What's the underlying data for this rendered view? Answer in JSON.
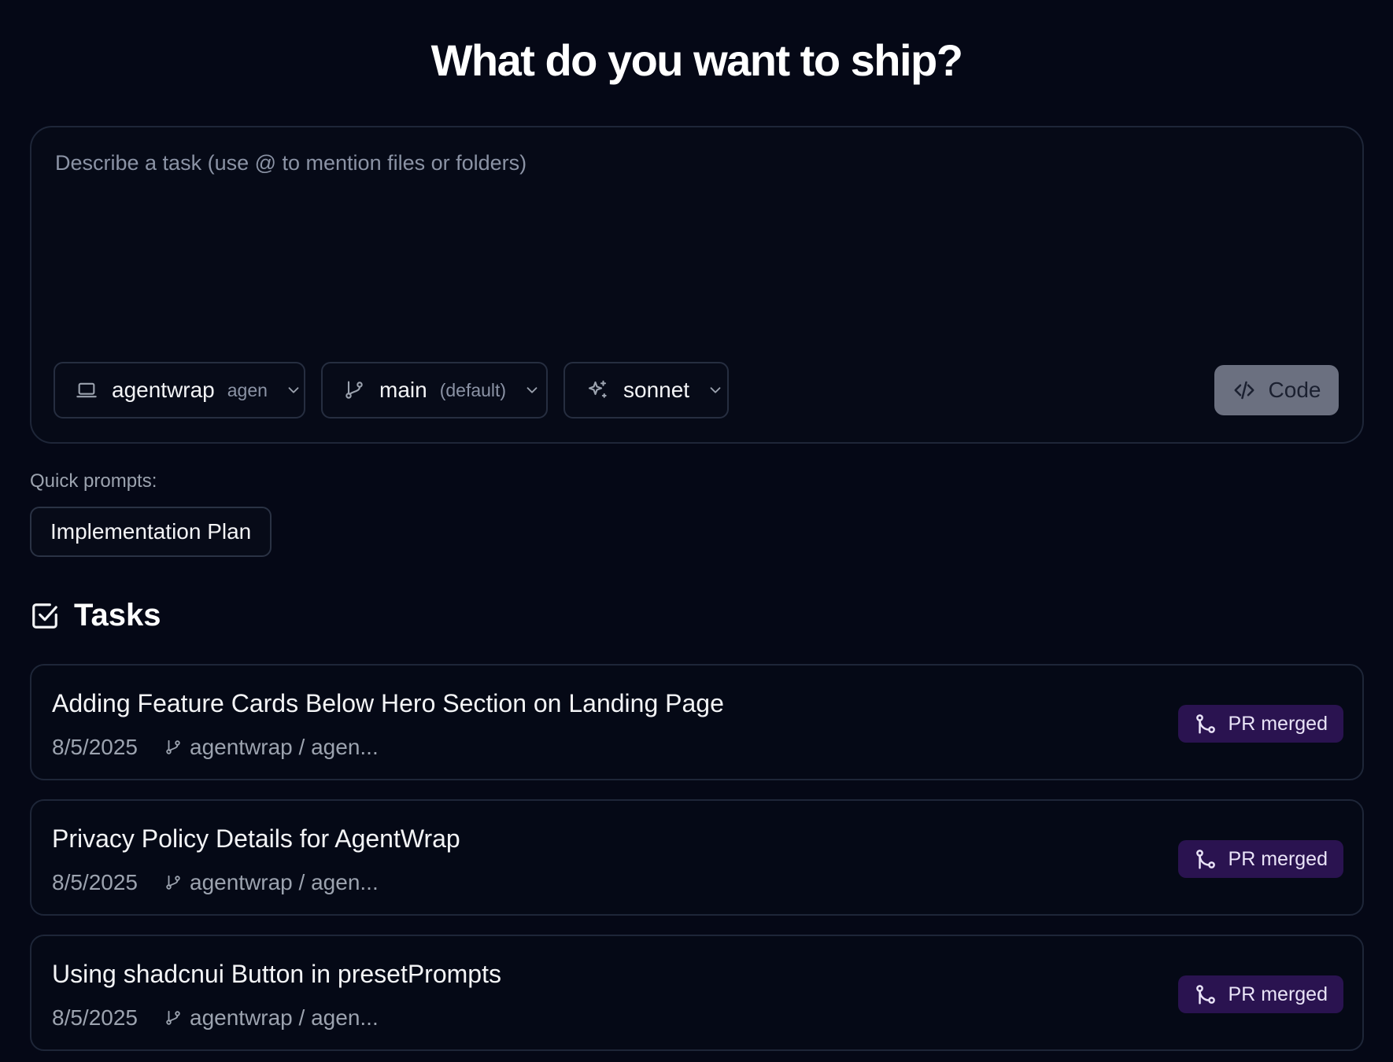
{
  "header": {
    "title": "What do you want to ship?"
  },
  "composer": {
    "placeholder": "Describe a task (use @ to mention files or folders)",
    "repo_selector": {
      "label": "agentwrap",
      "sub": "agen"
    },
    "branch_selector": {
      "label": "main",
      "sub": "(default)"
    },
    "model_selector": {
      "label": "sonnet"
    },
    "submit_label": "Code"
  },
  "quick_prompts": {
    "label": "Quick prompts:",
    "items": [
      "Implementation Plan"
    ]
  },
  "tasks": {
    "title": "Tasks",
    "items": [
      {
        "title": "Adding Feature Cards Below Hero Section on Landing Page",
        "date": "8/5/2025",
        "repo": "agentwrap / agen...",
        "status": "PR merged"
      },
      {
        "title": "Privacy Policy Details for AgentWrap",
        "date": "8/5/2025",
        "repo": "agentwrap / agen...",
        "status": "PR merged"
      },
      {
        "title": "Using shadcnui Button in presetPrompts",
        "date": "8/5/2025",
        "repo": "agentwrap / agen...",
        "status": "PR merged"
      }
    ]
  },
  "colors": {
    "background": "#050816",
    "badge": "#2a1350",
    "code_button": "#6b7080"
  }
}
